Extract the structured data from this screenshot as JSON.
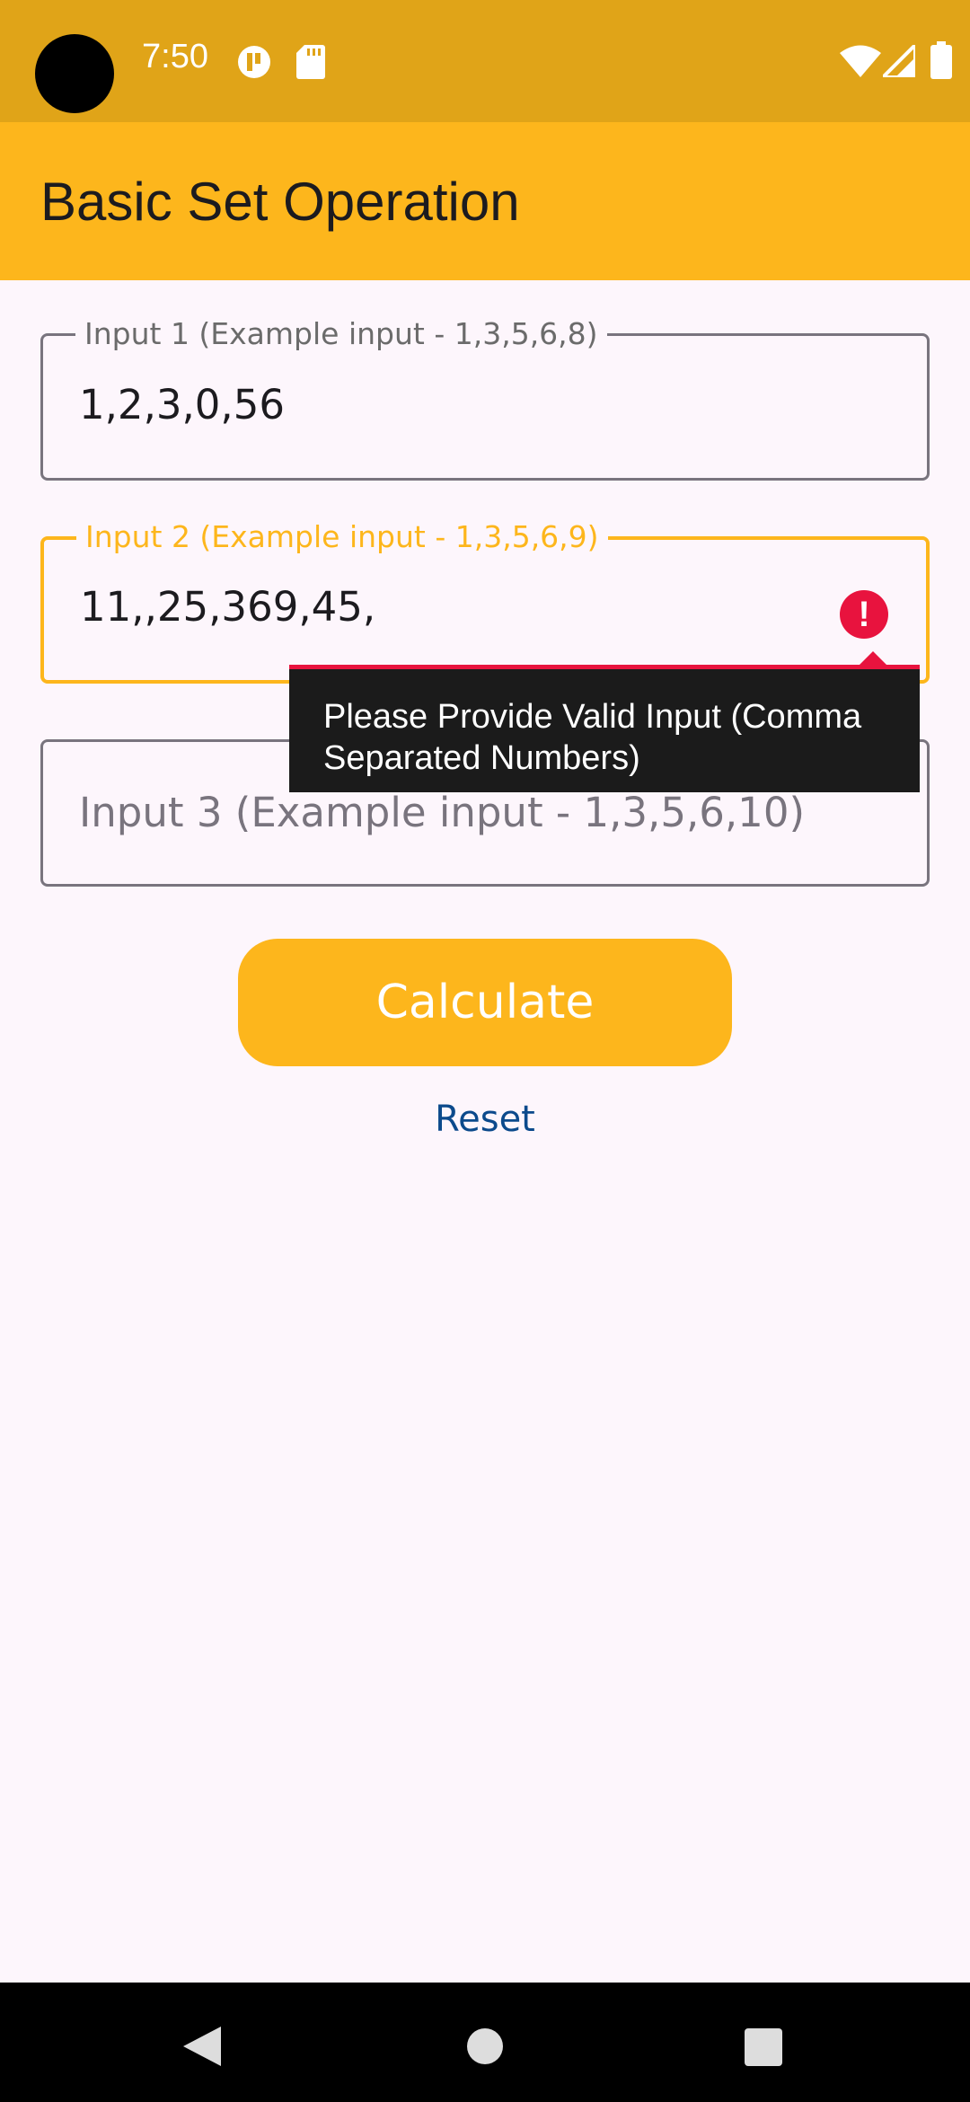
{
  "status_bar": {
    "time": "7:50",
    "icons": [
      "notification-app-icon",
      "sd-card-icon",
      "wifi-icon",
      "signal-icon",
      "battery-icon"
    ]
  },
  "app_bar": {
    "title": "Basic Set Operation"
  },
  "form": {
    "input1": {
      "label": "Input 1 (Example input - 1,3,5,6,8)",
      "value": "1,2,3,0,56"
    },
    "input2": {
      "label": "Input 2 (Example input - 1,3,5,6,9)",
      "value": "11,,25,369,45,",
      "error_icon": "!",
      "error_message": "Please Provide Valid Input (Comma Separated Numbers)"
    },
    "input3": {
      "placeholder": "Input 3 (Example input - 1,3,5,6,10)",
      "value": ""
    },
    "calculate_label": "Calculate",
    "reset_label": "Reset"
  },
  "colors": {
    "status_bar": "#e0a418",
    "primary": "#fdb61c",
    "error": "#e8133e",
    "link": "#0c4a8c",
    "background": "#fdf6fc"
  },
  "nav_bar": {
    "buttons": [
      "back-icon",
      "home-icon",
      "recents-icon"
    ]
  }
}
